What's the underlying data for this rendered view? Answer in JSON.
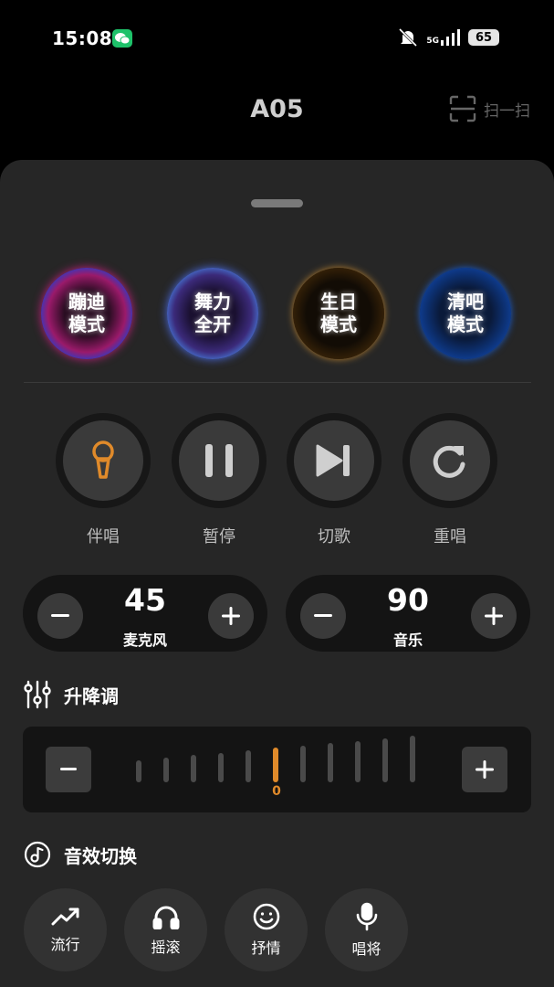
{
  "status": {
    "time": "15:08",
    "network": "5G",
    "battery": "65"
  },
  "header": {
    "title": "A05",
    "scan_label": "扫一扫"
  },
  "modes": [
    {
      "label": "蹦迪模式",
      "line1": "蹦迪",
      "line2": "模式"
    },
    {
      "label": "舞力全开",
      "line1": "舞力",
      "line2": "全开"
    },
    {
      "label": "生日模式",
      "line1": "生日",
      "line2": "模式"
    },
    {
      "label": "清吧模式",
      "line1": "清吧",
      "line2": "模式"
    }
  ],
  "controls": [
    {
      "label": "伴唱",
      "icon": "microphone-icon"
    },
    {
      "label": "暂停",
      "icon": "pause-icon"
    },
    {
      "label": "切歌",
      "icon": "skip-next-icon"
    },
    {
      "label": "重唱",
      "icon": "replay-icon"
    }
  ],
  "volumes": {
    "mic": {
      "value": "45",
      "label": "麦克风"
    },
    "music": {
      "value": "90",
      "label": "音乐"
    }
  },
  "pitch": {
    "title": "升降调",
    "value": "0",
    "levels": 11,
    "current_index": 5
  },
  "effects": {
    "title": "音效切换",
    "items": [
      {
        "label": "流行",
        "icon": "trend-icon"
      },
      {
        "label": "摇滚",
        "icon": "headphones-icon"
      },
      {
        "label": "抒情",
        "icon": "smile-icon"
      },
      {
        "label": "唱将",
        "icon": "microphone-icon"
      }
    ]
  },
  "colors": {
    "accent": "#e08a2a",
    "panel": "#262626"
  }
}
